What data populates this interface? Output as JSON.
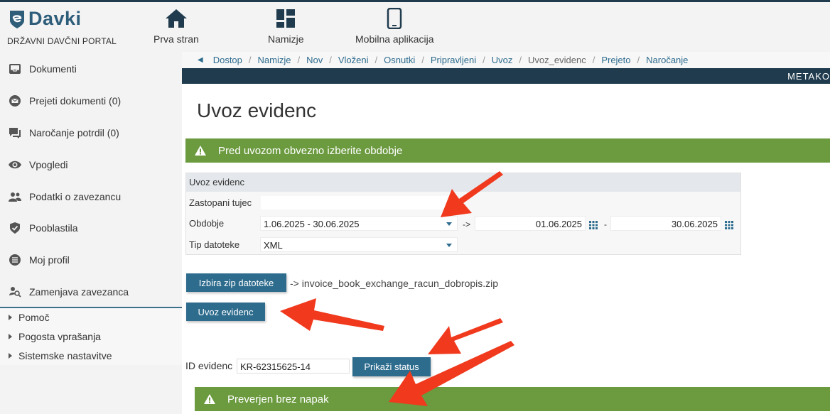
{
  "brand": {
    "name": "Davki",
    "subtitle": "DRŽAVNI DAVČNI PORTAL"
  },
  "topnav": [
    {
      "label": "Prva stran",
      "icon": "home-icon"
    },
    {
      "label": "Namizje",
      "icon": "dashboard-icon"
    },
    {
      "label": "Mobilna aplikacija",
      "icon": "mobile-phone-icon"
    }
  ],
  "sidebar": {
    "items": [
      {
        "label": "Dokumenti",
        "icon": "inbox-icon"
      },
      {
        "label": "Prejeti dokumenti (0)",
        "icon": "mail-icon"
      },
      {
        "label": "Naročanje potrdil (0)",
        "icon": "chat-icon"
      },
      {
        "label": "Vpogledi",
        "icon": "eye-icon"
      },
      {
        "label": "Podatki o zavezancu",
        "icon": "users-icon"
      },
      {
        "label": "Pooblastila",
        "icon": "shield-check-icon"
      },
      {
        "label": "Moj profil",
        "icon": "list-icon"
      },
      {
        "label": "Zamenjava zavezanca",
        "icon": "user-search-icon"
      }
    ],
    "sub_items": [
      {
        "label": "Pomoč"
      },
      {
        "label": "Pogosta vprašanja"
      },
      {
        "label": "Sistemske nastavitve"
      }
    ]
  },
  "breadcrumb": [
    "Dostop",
    "Namizje",
    "Nov",
    "Vloženi",
    "Osnutki",
    "Pripravljeni",
    "Uvoz",
    "Uvoz_evidenc",
    "Prejeto",
    "Naročanje"
  ],
  "breadcrumb_current_index": 7,
  "darkbar_text": "METAKO",
  "page": {
    "title": "Uvoz evidenc",
    "alert_top": "Pred uvozom obvezno izberite obdobje",
    "form": {
      "header": "Uvoz evidenc",
      "label_zastopani": "Zastopani tujec",
      "value_zastopani": "",
      "label_obdobje": "Obdobje",
      "value_obdobje": "1.06.2025 - 30.06.2025",
      "arrow_text": "->",
      "date_from": "01.06.2025",
      "dash": "-",
      "date_to": "30.06.2025",
      "label_tip": "Tip datoteke",
      "value_tip": "XML"
    },
    "zip_button": "Izbira zip datoteke",
    "zip_file": "-> invoice_book_exchange_racun_dobropis.zip",
    "import_button": "Uvoz evidenc",
    "id_label": "ID evidenc",
    "id_value": "KR-62315625-14",
    "status_button": "Prikaži status",
    "alert_bottom": "Preverjen brez napak"
  },
  "colors": {
    "brand_blue": "#2e5d7a",
    "button_blue": "#2e6c8e",
    "dark_bar": "#1f3b4d",
    "alert_green": "#6b9a3f",
    "annotation_red": "#f0391d"
  }
}
